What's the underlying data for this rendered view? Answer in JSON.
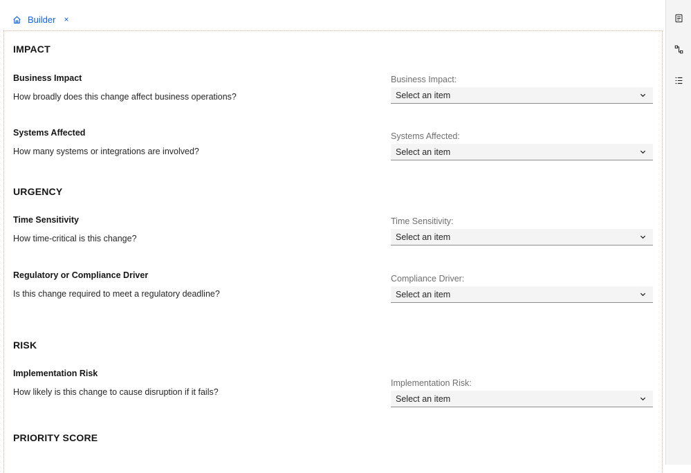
{
  "tab": {
    "label": "Builder",
    "close": "×"
  },
  "sections": {
    "impact": {
      "title": "IMPACT"
    },
    "urgency": {
      "title": "URGENCY"
    },
    "risk": {
      "title": "RISK"
    },
    "priority": {
      "title": "PRIORITY SCORE"
    }
  },
  "questions": {
    "business_impact": {
      "title": "Business Impact",
      "text": "How broadly does this change affect business operations?",
      "label": "Business Impact:",
      "value": "Select an item"
    },
    "systems_affected": {
      "title": "Systems Affected",
      "text": "How many systems or integrations are involved?",
      "label": "Systems Affected:",
      "value": "Select an item"
    },
    "time_sensitivity": {
      "title": "Time Sensitivity",
      "text": "How time-critical is this change?",
      "label": "Time Sensitivity:",
      "value": "Select an item"
    },
    "compliance_driver": {
      "title": "Regulatory or Compliance Driver",
      "text": "Is this change required to meet a regulatory deadline?",
      "label": "Compliance Driver:",
      "value": "Select an item"
    },
    "implementation_risk": {
      "title": "Implementation Risk",
      "text": "How likely is this change to cause disruption if it fails?",
      "label": "Implementation Risk:",
      "value": "Select an item"
    }
  },
  "rail": {
    "icons": [
      "document-icon",
      "flow-icon",
      "list-icon"
    ]
  },
  "colors": {
    "accent": "#0f62fe",
    "canvas_border": "#f2a88b",
    "field_bg": "#f4f4f4"
  }
}
